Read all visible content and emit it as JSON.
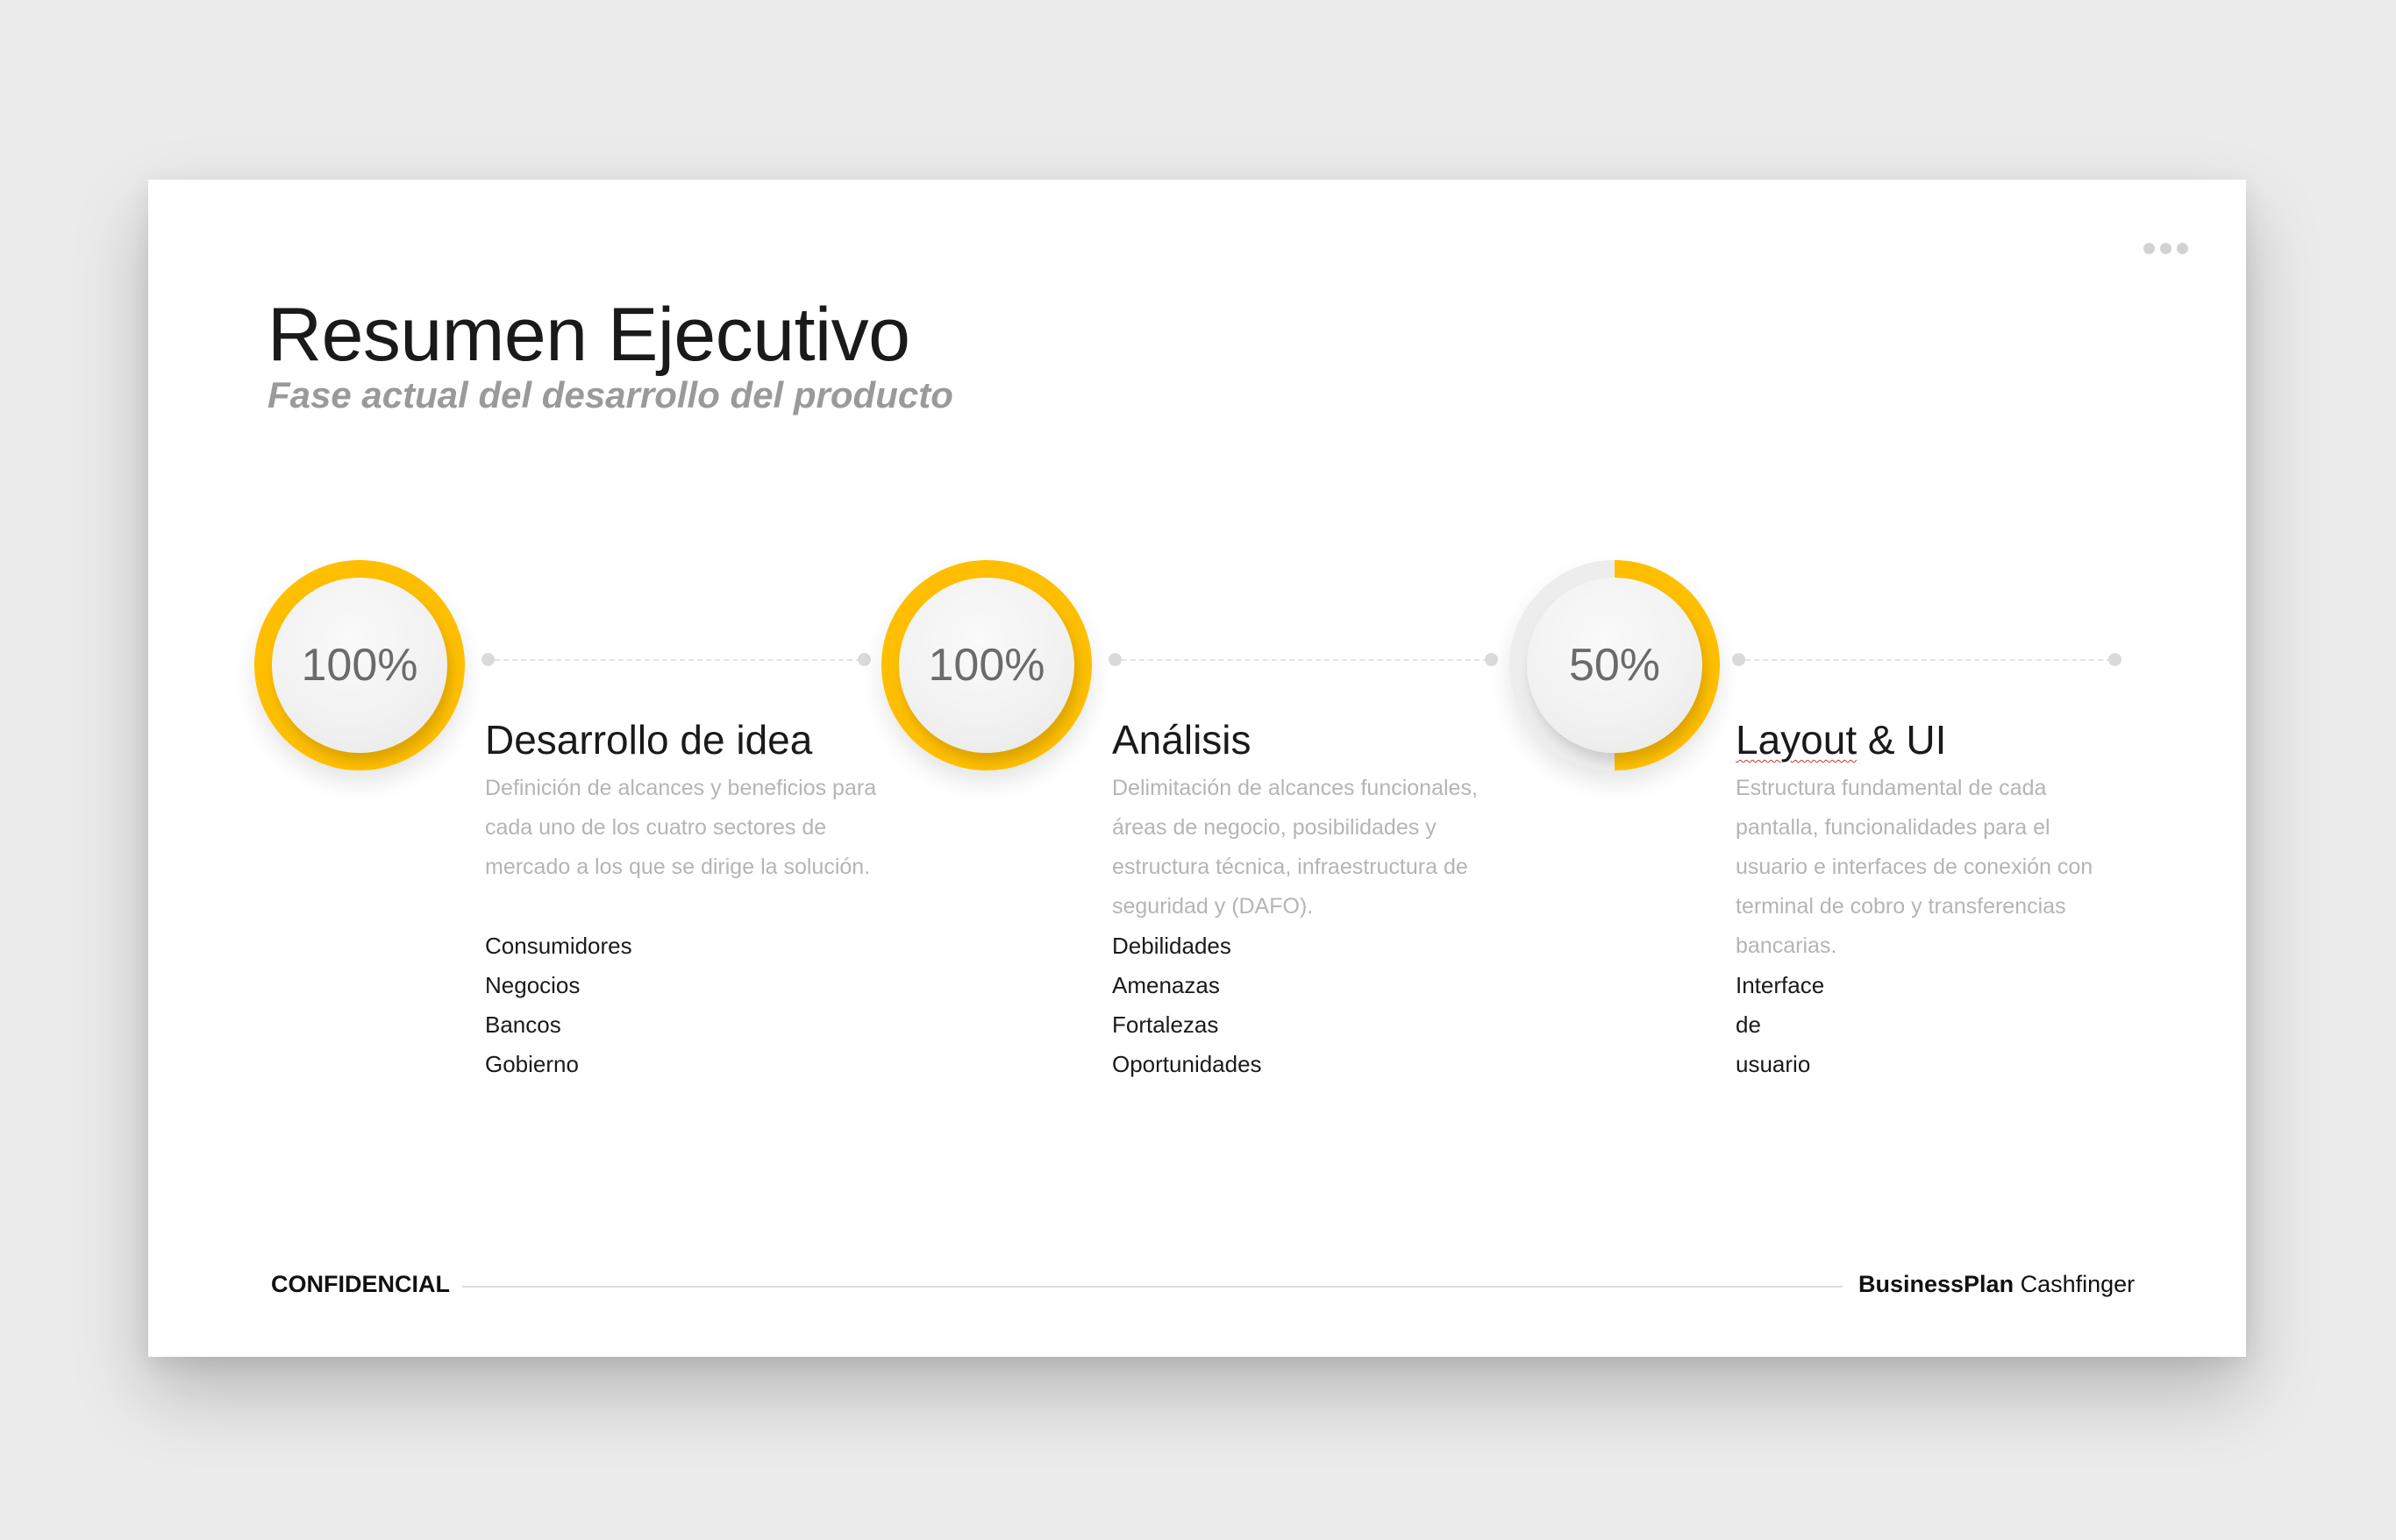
{
  "header": {
    "title": "Resumen Ejecutivo",
    "subtitle": "Fase actual del desarrollo del producto"
  },
  "colors": {
    "accent": "#ffbf00",
    "track": "#ededed"
  },
  "stages": [
    {
      "percent_label": "100%",
      "progress": 1.0,
      "title": "Desarrollo de idea",
      "description": "Definición de alcances y beneficios para cada uno de los cuatro sectores de mercado a los que se dirige la solución.",
      "items": [
        "Consumidores",
        "Negocios",
        "Bancos",
        "Gobierno"
      ]
    },
    {
      "percent_label": "100%",
      "progress": 1.0,
      "title": "Análisis",
      "description": "Delimitación de alcances funcionales, áreas de negocio, posibilidades y estructura técnica, infraestructura de seguridad y (DAFO).",
      "items": [
        "Debilidades",
        "Amenazas",
        "Fortalezas",
        "Oportunidades"
      ]
    },
    {
      "percent_label": "50%",
      "progress": 0.5,
      "title_a": "Layout",
      "title_b": " & UI",
      "description": "Estructura fundamental de cada pantalla, funcionalidades para el usuario e interfaces de conexión con terminal de cobro y transferencias bancarias.",
      "items": [
        "Interface de usuario"
      ]
    }
  ],
  "footer": {
    "left": "CONFIDENCIAL",
    "brand_bold": "BusinessPlan",
    "brand_regular": " Cashfinger"
  }
}
